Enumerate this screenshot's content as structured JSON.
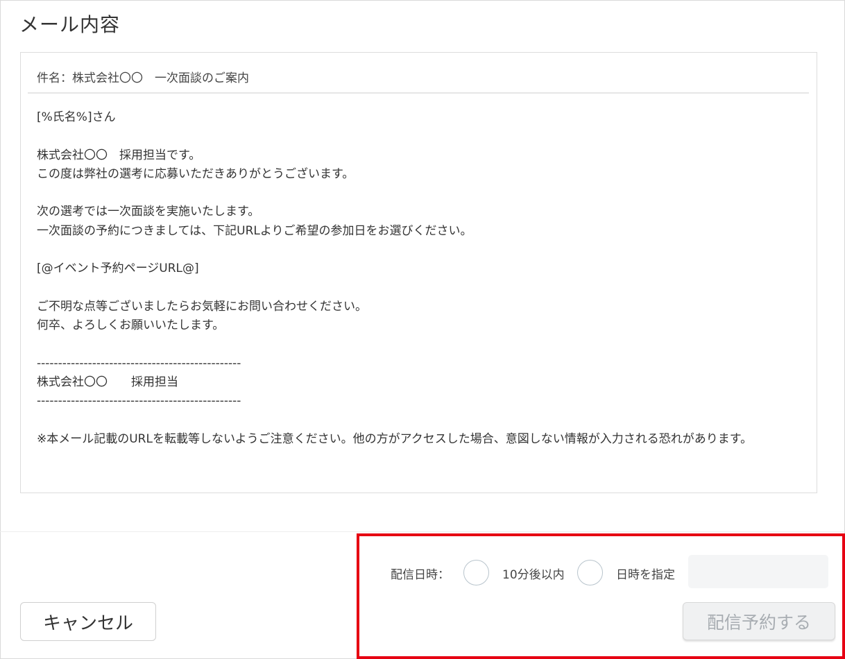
{
  "page": {
    "title": "メール内容"
  },
  "mail": {
    "subject": "件名：株式会社〇〇　一次面談のご案内",
    "body_lines": [
      "[%氏名%]さん",
      "",
      "株式会社〇〇　採用担当です。",
      "この度は弊社の選考に応募いただきありがとうございます。",
      "",
      "次の選考では一次面談を実施いたします。",
      "一次面談の予約につきましては、下記URLよりご希望の参加日をお選びください。",
      "",
      "[@イベント予約ページURL@]",
      "",
      "ご不明な点等ございましたらお気軽にお問い合わせください。",
      "何卒、よろしくお願いいたします。",
      "",
      "------------------------------------------------",
      "株式会社〇〇　　採用担当",
      "------------------------------------------------",
      "",
      "※本メール記載のURLを転載等しないようご注意ください。他の方がアクセスした場合、意図しない情報が入力される恐れがあります。"
    ]
  },
  "footer": {
    "cancel_label": "キャンセル",
    "delivery": {
      "label": "配信日時：",
      "option_1": "10分後以内",
      "option_2": "日時を指定",
      "datetime_value": ""
    },
    "schedule_label": "配信予約する"
  },
  "colors": {
    "highlight": "#e60012",
    "disabled_text": "#a8adb2",
    "disabled_bg": "#f0f1f2"
  }
}
